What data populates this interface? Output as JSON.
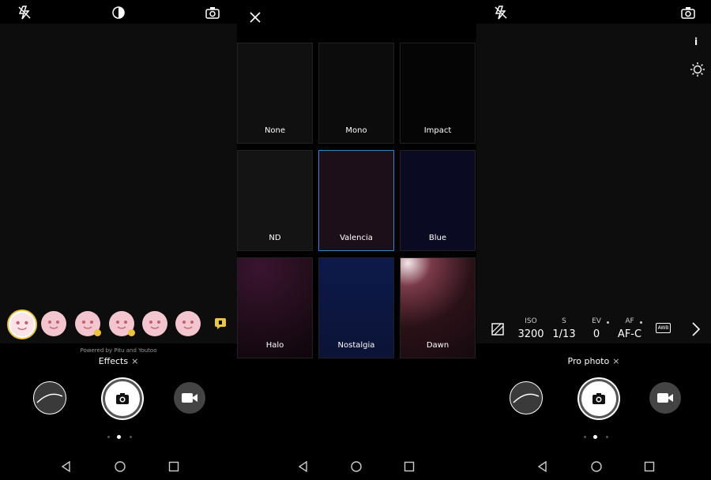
{
  "effects_panel": {
    "powered_by": "Powered by Pitu and Youtoo",
    "mode_label": "Effects",
    "close_glyph": "×",
    "top_icons": [
      "flash-off-icon",
      "beauty-icon",
      "switch-camera-icon"
    ],
    "stickers": [
      {
        "name": "sunglasses-sticker",
        "selected": true,
        "badge": false
      },
      {
        "name": "pink-face-sticker",
        "selected": false,
        "badge": false
      },
      {
        "name": "bunny-sticker",
        "selected": false,
        "badge": true
      },
      {
        "name": "cat-sticker",
        "selected": false,
        "badge": true
      },
      {
        "name": "heart-eyes-sticker",
        "selected": false,
        "badge": false
      },
      {
        "name": "pig-sticker",
        "selected": false,
        "badge": false
      }
    ]
  },
  "filters_panel": {
    "close_glyph": "×",
    "filters": [
      {
        "label": "None",
        "color": "#101010",
        "selected": false
      },
      {
        "label": "Mono",
        "color": "#0c0c0c",
        "selected": false
      },
      {
        "label": "Impact",
        "color": "#050505",
        "selected": false
      },
      {
        "label": "ND",
        "color": "#141414",
        "selected": false
      },
      {
        "label": "Valencia",
        "color": "#1c0f1a",
        "selected": true
      },
      {
        "label": "Blue",
        "color": "#0a0a22",
        "selected": false
      },
      {
        "label": "Halo",
        "color": "#1e0c18",
        "selected": false
      },
      {
        "label": "Nostalgia",
        "color": "#0b1336",
        "selected": false
      },
      {
        "label": "Dawn",
        "color": "#2a1118",
        "selected": false
      }
    ]
  },
  "pro_panel": {
    "mode_label": "Pro photo",
    "close_glyph": "×",
    "info_glyph": "i",
    "params": [
      {
        "key": "ISO",
        "value": "3200"
      },
      {
        "key": "S",
        "value": "1/13"
      },
      {
        "key": "EV",
        "value": "0"
      },
      {
        "key": "AF",
        "value": "AF-C"
      }
    ],
    "awb_label": "AWB"
  },
  "colors": {
    "accent_yellow": "#e8c547",
    "selection_blue": "#2f86c8",
    "sticker_pink": "#f3c6cf"
  }
}
